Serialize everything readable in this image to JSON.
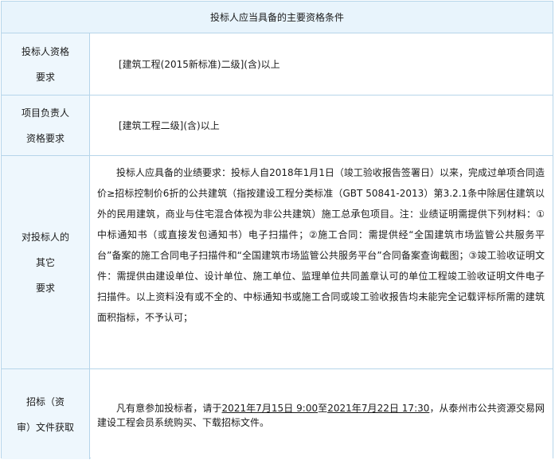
{
  "header": "投标人应当具备的主要资格条件",
  "rows": [
    {
      "label_l1": "投标人资格",
      "label_l2": "要求",
      "value": "[建筑工程(2015新标准)二级](含)以上"
    },
    {
      "label_l1": "项目负责人",
      "label_l2": "资格要求",
      "value": "[建筑工程二级](含)以上"
    },
    {
      "label_l1": "对投标人的",
      "label_l2": "其它",
      "label_l3": "要求",
      "value": "投标人应具备的业绩要求：投标人自2018年1月1日（竣工验收报告签署日）以来，完成过单项合同造价≥招标控制价6折的公共建筑（指按建设工程分类标准（GBT 50841-2013）第3.2.1条中除居住建筑以外的民用建筑，商业与住宅混合体视为非公共建筑）施工总承包项目。注：业绩证明需提供下列材料：①中标通知书（或直接发包通知书）电子扫描件；②施工合同：需提供经“全国建筑市场监管公共服务平台”备案的施工合同电子扫描件和“全国建筑市场监管公共服务平台”合同备案查询截图；③竣工验收证明文件：需提供由建设单位、设计单位、施工单位、监理单位共同盖章认可的单位工程竣工验收证明文件电子扫描件。以上资料没有或不全的、中标通知书或施工合同或竣工验收报告均未能完全记载评标所需的建筑面积指标，不予认可；"
    },
    {
      "label_l1": "招标（资",
      "label_l2": "审）文件获取",
      "text_a": "凡有意参加投标者，请于",
      "date_start": "2021年7月15日 9:00",
      "text_b": "至",
      "date_end": "2021年7月22日 17:30",
      "text_c": "，从泰州市公共资源交易网建设工程会员系统购买、下载招标文件。"
    }
  ]
}
